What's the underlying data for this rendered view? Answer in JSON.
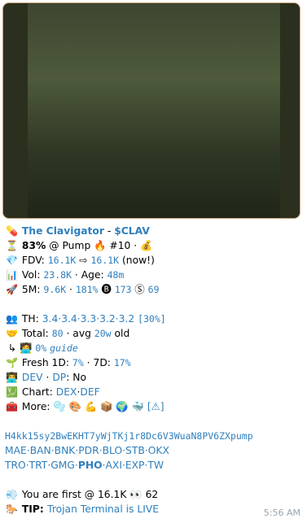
{
  "token": {
    "name": "The Clavigator",
    "sep": " - ",
    "ticker": "$CLAV"
  },
  "status": {
    "pct": "83%",
    "at": " @ Pump ",
    "rank": " #10 · "
  },
  "fdv": {
    "label": "FDV: ",
    "from": "16.1K",
    "arrow": " ⇨ ",
    "to": "16.1K",
    "suffix": " (now!)"
  },
  "vol": {
    "label": "Vol: ",
    "value": "23.8K",
    "age_label": " · Age: ",
    "age": "48m"
  },
  "five_m": {
    "label": "5M: ",
    "change": "9.6K",
    "sep": " · ",
    "pct": "181%",
    "b_count": "173",
    "s_count": "69"
  },
  "th": {
    "label": "TH: ",
    "values": "3.4·3.4·3.3·3.2·3.2",
    "total": "[30%]"
  },
  "total": {
    "label": "Total: ",
    "value": "80",
    "avg_label": " · avg ",
    "avg": "20w",
    "suffix": " old"
  },
  "guide": {
    "pct": "0%",
    "link": "guide"
  },
  "fresh": {
    "label": "Fresh 1D: ",
    "d1": "7%",
    "sep": " · 7D: ",
    "d7": "17%"
  },
  "dev": {
    "dev": "DEV",
    "sep": " · ",
    "dp": "DP",
    "suffix": ": No"
  },
  "chart": {
    "label": "Chart: ",
    "dex": "DEX",
    "sep": "·",
    "def": "DEF"
  },
  "more": {
    "label": "More: "
  },
  "contract": "H4kk15sy2BwEKHT7yWjTKj1r8Dc6V3WuaN8PV6ZXpump",
  "links_row1": "MAE·BAN·BNK·PDR·BLO·STB·OKX",
  "links_row2": {
    "a": "TRO·TRT·GMG·",
    "b": "PHO",
    "c": "·AXI·EXP·TW"
  },
  "first": {
    "text": "You are first @ 16.1K ",
    "count": "62"
  },
  "tip": {
    "label": "TIP: ",
    "link": "Trojan Terminal is LIVE"
  },
  "timestamp": "5:56 AM"
}
